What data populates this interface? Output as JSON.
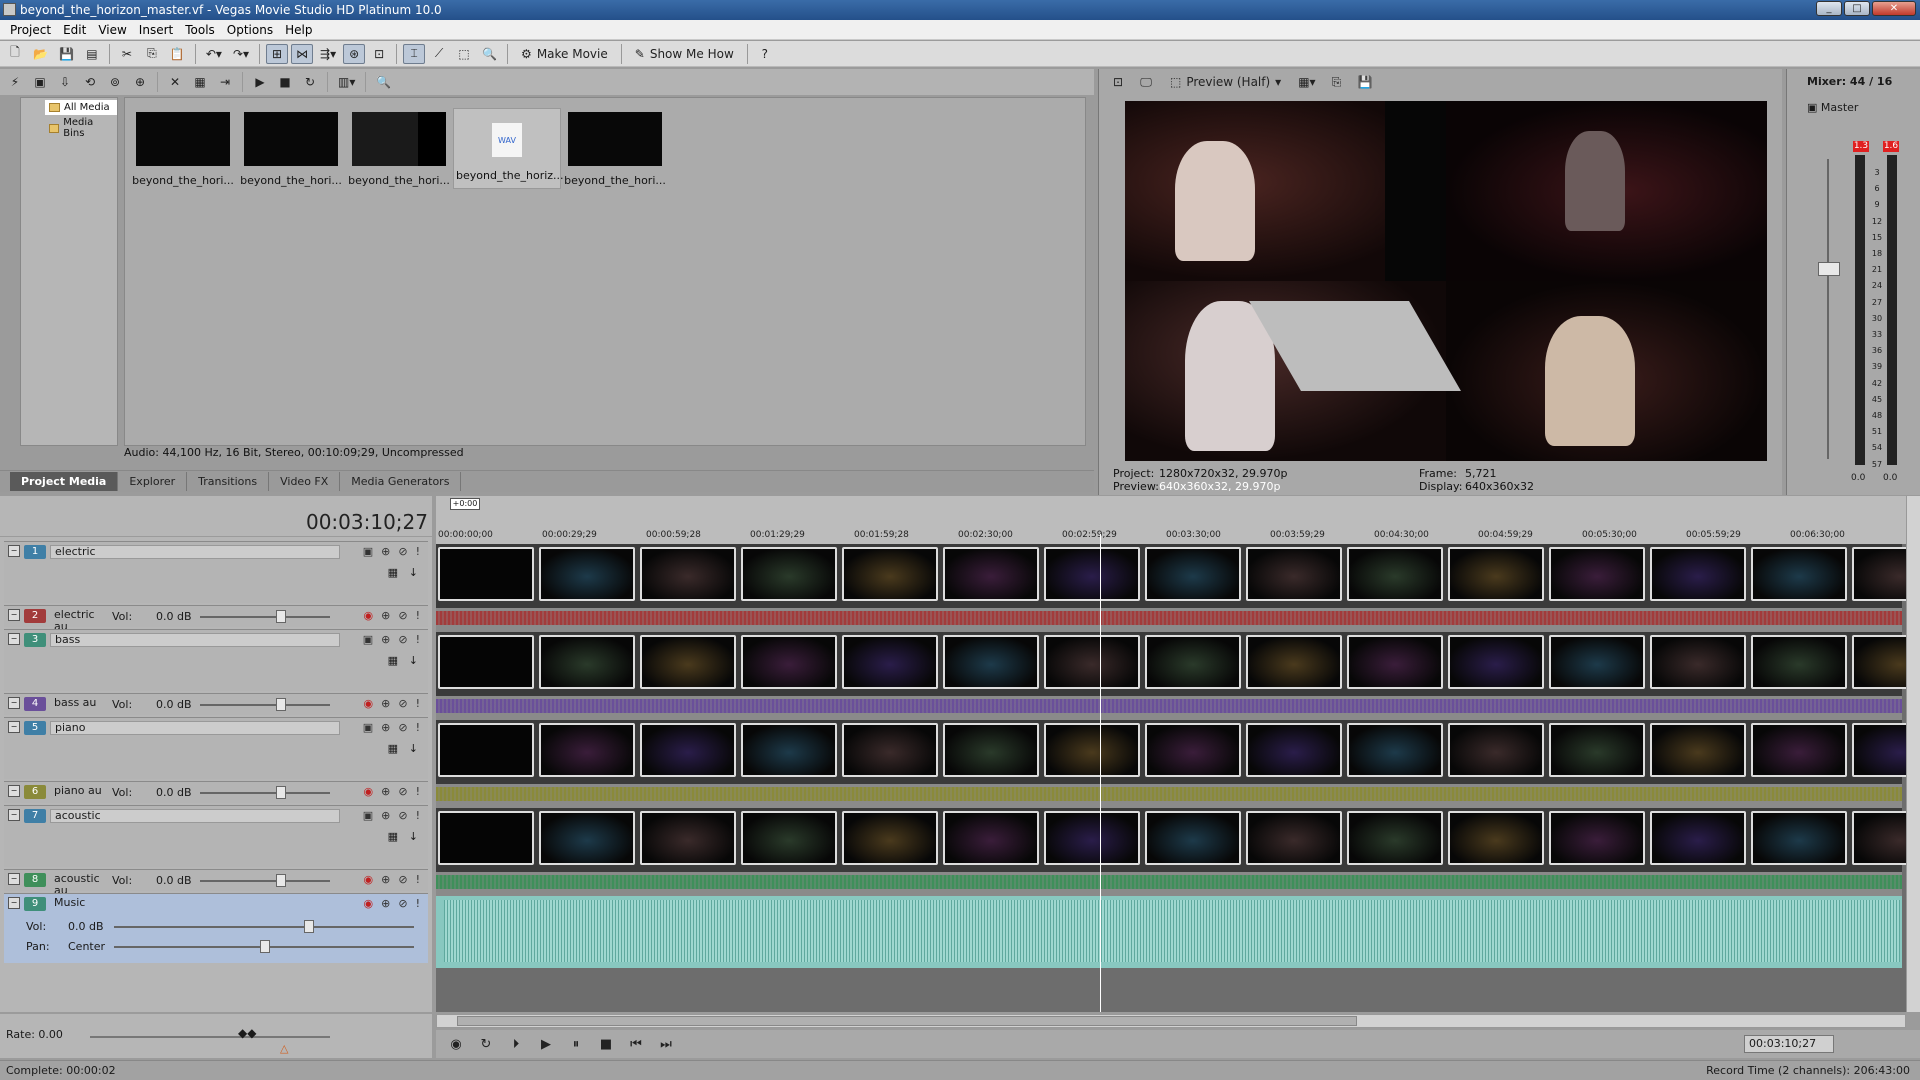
{
  "window": {
    "title": "beyond_the_horizon_master.vf - Vegas Movie Studio HD Platinum 10.0"
  },
  "menu": [
    "Project",
    "Edit",
    "View",
    "Insert",
    "Tools",
    "Options",
    "Help"
  ],
  "toolbar": {
    "make_movie": "Make Movie",
    "show_me_how": "Show Me How"
  },
  "media_tree": {
    "items": [
      "All Media",
      "Media Bins"
    ]
  },
  "media": {
    "files": [
      "beyond_the_hori...",
      "beyond_the_hori...",
      "beyond_the_hori...",
      "beyond_the_horiz...",
      "beyond_the_hori..."
    ],
    "wav_badge": "WAV",
    "status": "Audio: 44,100 Hz, 16 Bit, Stereo, 00:10:09;29, Uncompressed"
  },
  "tabs": [
    "Project Media",
    "Explorer",
    "Transitions",
    "Video FX",
    "Media Generators"
  ],
  "preview": {
    "mode": "Preview (Half)",
    "project_label": "Project:",
    "project_value": "1280x720x32, 29.970p",
    "preview_label": "Preview:",
    "preview_value": "640x360x32, 29.970p",
    "frame_label": "Frame:",
    "frame_value": "5,721",
    "display_label": "Display:",
    "display_value": "640x360x32"
  },
  "mixer": {
    "title": "Mixer: 44 / 16",
    "master": "Master",
    "peak_left": "1.3",
    "peak_right": "1.6",
    "scale": [
      "3",
      "6",
      "9",
      "12",
      "15",
      "18",
      "21",
      "24",
      "27",
      "30",
      "33",
      "36",
      "39",
      "42",
      "45",
      "48",
      "51",
      "54",
      "57"
    ],
    "bottom_left": "0.0",
    "bottom_right": "0.0"
  },
  "timeline": {
    "timecode": "00:03:10;27",
    "marker": "+0:00",
    "ruler": [
      "00:00:00;00",
      "00:00:29;29",
      "00:00:59;28",
      "00:01:29;29",
      "00:01:59;28",
      "00:02:30;00",
      "00:02:59;29",
      "00:03:30;00",
      "00:03:59;29",
      "00:04:30;00",
      "00:04:59;29",
      "00:05:30;00",
      "00:05:59;29",
      "00:06:30;00"
    ],
    "playhead_seconds": 190.9
  },
  "tracks": [
    {
      "num": "1",
      "name": "electric",
      "type": "video",
      "color": "#3f7fa6"
    },
    {
      "num": "2",
      "name": "electric au",
      "type": "audio",
      "vol_label": "Vol:",
      "vol": "0.0 dB",
      "color": "#a23b3b"
    },
    {
      "num": "3",
      "name": "bass",
      "type": "video",
      "color": "#3f8f7a"
    },
    {
      "num": "4",
      "name": "bass au",
      "type": "audio",
      "vol_label": "Vol:",
      "vol": "0.0 dB",
      "color": "#6a4f9a"
    },
    {
      "num": "5",
      "name": "piano",
      "type": "video",
      "color": "#3f7fa6"
    },
    {
      "num": "6",
      "name": "piano au",
      "type": "audio",
      "vol_label": "Vol:",
      "vol": "0.0 dB",
      "color": "#8a8a3a"
    },
    {
      "num": "7",
      "name": "acoustic",
      "type": "video",
      "color": "#3f7fa6"
    },
    {
      "num": "8",
      "name": "acoustic au",
      "type": "audio",
      "vol_label": "Vol:",
      "vol": "0.0 dB",
      "color": "#3f8f5a"
    },
    {
      "num": "9",
      "name": "Music",
      "type": "music",
      "vol_label": "Vol:",
      "vol": "0.0 dB",
      "pan_label": "Pan:",
      "pan": "Center",
      "color": "#3f8f7a"
    }
  ],
  "rate": "Rate: 0.00",
  "transport_timecode": "00:03:10;27",
  "status": {
    "left": "Complete: 00:00:02",
    "right": "Record Time (2 channels): 206:43:00"
  }
}
